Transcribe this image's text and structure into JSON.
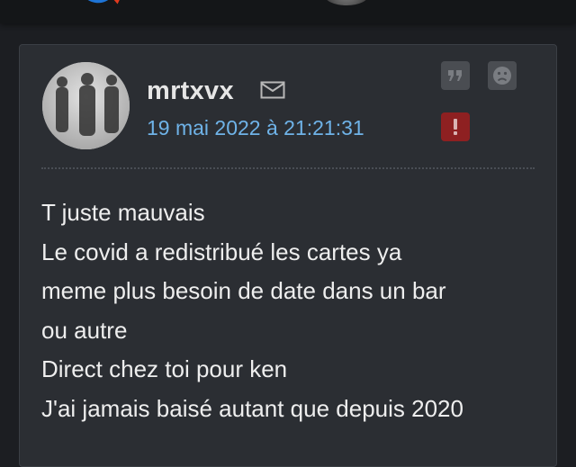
{
  "post": {
    "username": "mrtxvx",
    "date": "19 mai 2022 à 21:21:31",
    "message_lines": [
      "T juste mauvais",
      "Le covid a redistribué les cartes ya",
      "meme plus besoin de date dans un bar",
      "ou autre",
      "Direct chez toi pour ken",
      "J'ai jamais baisé autant que depuis 2020"
    ]
  },
  "actions": {
    "quote_icon": "quote-icon",
    "sad_icon": "sad-face-icon",
    "alert_icon": "exclamation-icon",
    "mail_icon": "envelope-icon"
  },
  "colors": {
    "date": "#6fb3e8",
    "alert_button": "#8e2021",
    "action_button": "#4a4d52",
    "card_background": "#2b2e33",
    "page_background": "#1c1e22"
  }
}
